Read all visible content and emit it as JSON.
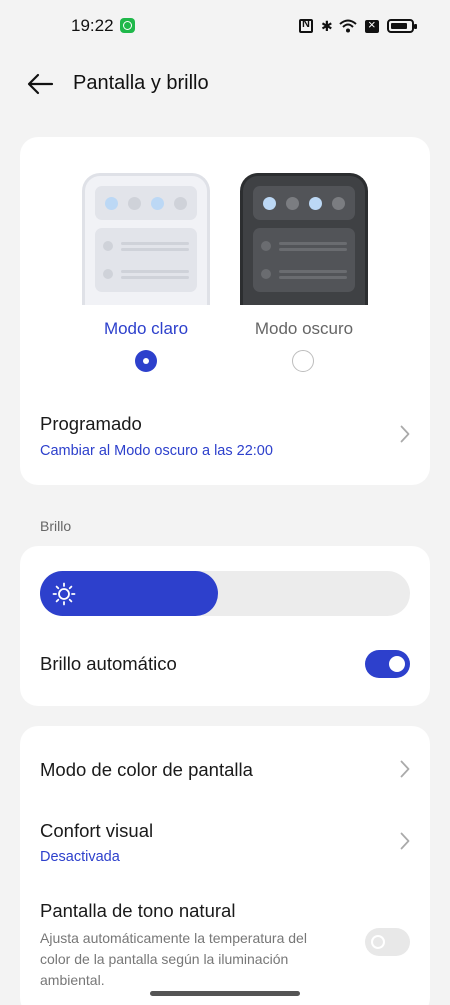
{
  "status_bar": {
    "time": "19:22",
    "icons": [
      "app-notification-icon",
      "nfc-icon",
      "bluetooth-icon",
      "wifi-icon",
      "no-sim-icon",
      "battery-icon"
    ]
  },
  "header": {
    "title": "Pantalla y brillo",
    "back_icon": "arrow-left-icon"
  },
  "theme": {
    "light_label": "Modo claro",
    "dark_label": "Modo oscuro",
    "selected": "light"
  },
  "schedule": {
    "title": "Programado",
    "subtitle": "Cambiar al Modo oscuro a las 22:00"
  },
  "brightness": {
    "section_label": "Brillo",
    "level": 0.48,
    "auto_label": "Brillo automático",
    "auto_enabled": true
  },
  "more": {
    "color_mode_title": "Modo de color de pantalla",
    "comfort_title": "Confort visual",
    "comfort_subtitle": "Desactivada",
    "natural_tone_title": "Pantalla de tono natural",
    "natural_tone_desc": "Ajusta automáticamente la temperatura del color de la pantalla según la iluminación ambiental.",
    "natural_tone_enabled": false
  },
  "colors": {
    "accent": "#2d40cc",
    "background": "#f3f3f3",
    "card": "#ffffff"
  }
}
